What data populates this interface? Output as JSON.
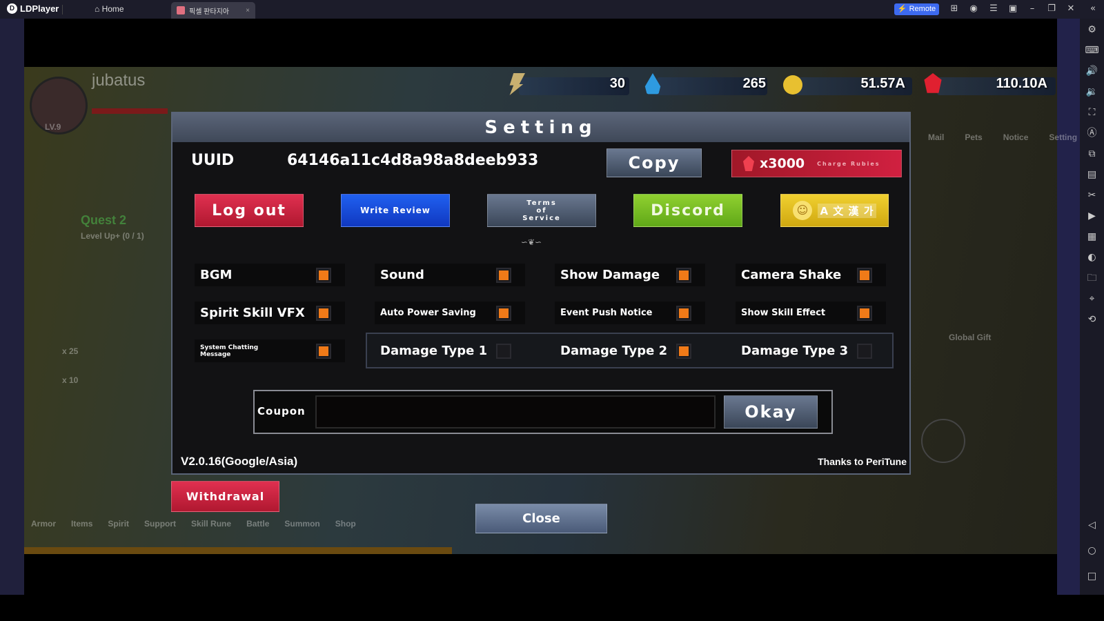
{
  "emulator": {
    "brand": "LDPlayer",
    "home_tab": "Home",
    "game_tab": "픽셀 판타지아",
    "remote_label": "Remote"
  },
  "hud": {
    "player_name": "jubatus",
    "level": "LV.9",
    "energy": "30",
    "water": "265",
    "gold": "51.57A",
    "ruby": "110.10A"
  },
  "background": {
    "quest": "Quest 2",
    "quest_detail": "Level Up+ (0 / 1)",
    "item_count_1": "x 25",
    "item_count_2": "x 10",
    "global_gift": "Global Gift",
    "nav": [
      "Armor",
      "Items",
      "Spirit",
      "Support",
      "Skill Rune",
      "Battle",
      "Summon",
      "Shop"
    ],
    "top_right": [
      "Mail",
      "Pets",
      "Notice",
      "Setting"
    ]
  },
  "setting": {
    "title": "Setting",
    "uuid_label": "UUID",
    "uuid_value": "64146a11c4d8a98a8deeb933",
    "copy_label": "Copy",
    "ruby_offer": "x3000",
    "ruby_offer_sub": "Charge Rubies",
    "buttons": {
      "logout": "Log out",
      "write_review": "Write Review",
      "terms": "Terms of Service",
      "discord": "Discord",
      "language": "A 文 漢 가"
    },
    "toggles": [
      {
        "label": "BGM",
        "on": true
      },
      {
        "label": "Sound",
        "on": true
      },
      {
        "label": "Show Damage",
        "on": true
      },
      {
        "label": "Camera Shake",
        "on": true
      },
      {
        "label": "Spirit Skill VFX",
        "on": true
      },
      {
        "label": "Auto Power Saving",
        "on": true
      },
      {
        "label": "Event Push Notice",
        "on": true
      },
      {
        "label": "Show Skill Effect",
        "on": true
      },
      {
        "label": "System Chatting Message",
        "on": true
      },
      {
        "label": "Damage Type 1",
        "on": false
      },
      {
        "label": "Damage Type 2",
        "on": true
      },
      {
        "label": "Damage Type 3",
        "on": false
      }
    ],
    "coupon_label": "Coupon",
    "coupon_value": "",
    "okay_label": "Okay",
    "version": "V2.0.16(Google/Asia)",
    "credits": "Thanks to PeriTune"
  },
  "withdrawal_label": "Withdrawal",
  "close_label": "Close",
  "colors": {
    "toggle_on": "#f07a18",
    "logout": "#c8203a",
    "review": "#1a4ee0",
    "discord": "#7cc020",
    "language": "#e8c020",
    "remote": "#3d6af0"
  }
}
